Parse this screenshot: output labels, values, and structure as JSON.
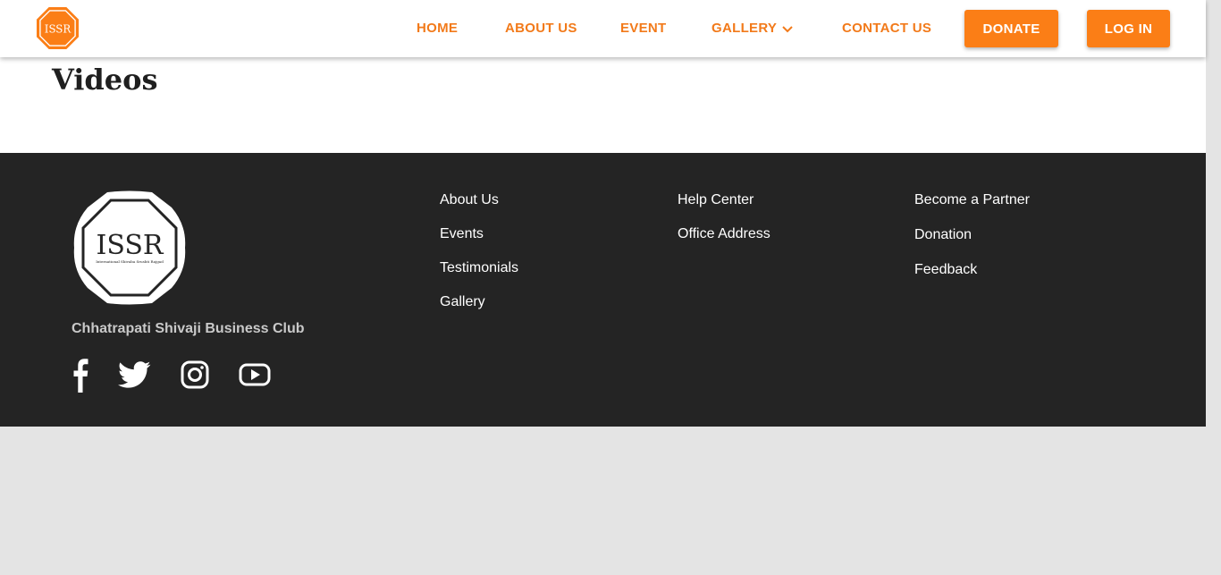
{
  "brand": {
    "logo_text": "ISSR",
    "logo_subtext": "International Shivaba Srushti Rajgad",
    "accent_color": "#fb7e16",
    "nav_text_color": "#f27a1a"
  },
  "nav": {
    "home": "HOME",
    "about": "ABOUT US",
    "event": "EVENT",
    "gallery": "GALLERY",
    "contact": "CONTACT US",
    "donate": "DONATE",
    "login": "LOG IN"
  },
  "main": {
    "title": "Videos"
  },
  "footer": {
    "club_name": "Chhatrapati Shivaji Business Club",
    "background_color": "#242424",
    "social": [
      "facebook-icon",
      "twitter-icon",
      "instagram-icon",
      "youtube-icon"
    ],
    "col1": [
      "About Us",
      "Events",
      "Testimonials",
      "Gallery"
    ],
    "col2": [
      "Help Center",
      "Office Address"
    ],
    "col3": [
      "Become a Partner",
      "Donation",
      "Feedback"
    ]
  }
}
